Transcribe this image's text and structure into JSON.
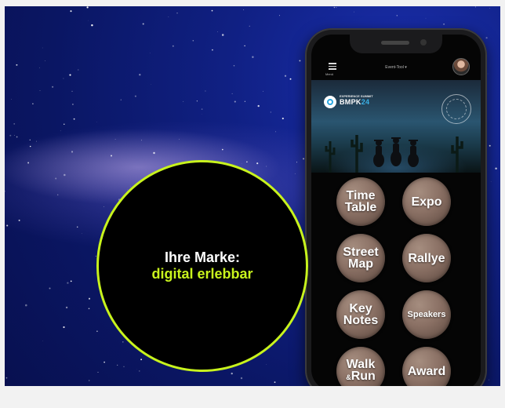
{
  "bubble": {
    "headline": "Ihre Marke:",
    "highlight": "digital erlebbar",
    "accent_color": "#c8f31d"
  },
  "phone": {
    "appbar": {
      "menu_icon": "hamburger-menu-icon",
      "menu_label": "Menü",
      "center_title": "Event-Tool ▾",
      "avatar_icon": "user-avatar"
    },
    "banner": {
      "brand_small": "EXPERIENCE SUMMIT",
      "brand_main": "BMPK",
      "brand_suffix": "24",
      "brand_accent": "#3ab0e6"
    },
    "buttons": [
      {
        "label": "Time\nTable"
      },
      {
        "label": "Expo"
      },
      {
        "label": "Street\nMap"
      },
      {
        "label": "Rallye"
      },
      {
        "label": "Key\nNotes"
      },
      {
        "label": "Speakers"
      },
      {
        "label_main": "Walk",
        "label_amp": "&",
        "label_end": "Run"
      },
      {
        "label": "Award"
      }
    ]
  }
}
